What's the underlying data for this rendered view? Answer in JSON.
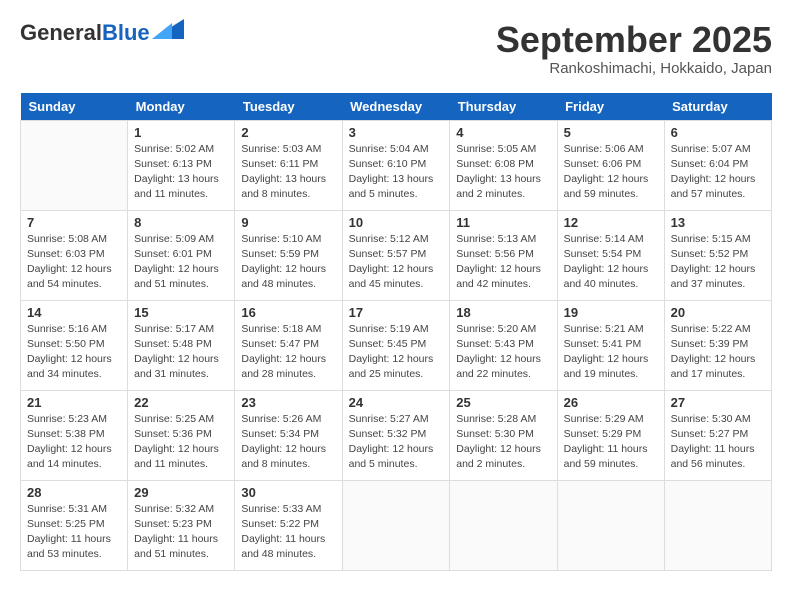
{
  "header": {
    "logo_general": "General",
    "logo_blue": "Blue",
    "month_title": "September 2025",
    "subtitle": "Rankoshimachi, Hokkaido, Japan"
  },
  "days_of_week": [
    "Sunday",
    "Monday",
    "Tuesday",
    "Wednesday",
    "Thursday",
    "Friday",
    "Saturday"
  ],
  "weeks": [
    [
      {
        "day": "",
        "info": ""
      },
      {
        "day": "1",
        "info": "Sunrise: 5:02 AM\nSunset: 6:13 PM\nDaylight: 13 hours\nand 11 minutes."
      },
      {
        "day": "2",
        "info": "Sunrise: 5:03 AM\nSunset: 6:11 PM\nDaylight: 13 hours\nand 8 minutes."
      },
      {
        "day": "3",
        "info": "Sunrise: 5:04 AM\nSunset: 6:10 PM\nDaylight: 13 hours\nand 5 minutes."
      },
      {
        "day": "4",
        "info": "Sunrise: 5:05 AM\nSunset: 6:08 PM\nDaylight: 13 hours\nand 2 minutes."
      },
      {
        "day": "5",
        "info": "Sunrise: 5:06 AM\nSunset: 6:06 PM\nDaylight: 12 hours\nand 59 minutes."
      },
      {
        "day": "6",
        "info": "Sunrise: 5:07 AM\nSunset: 6:04 PM\nDaylight: 12 hours\nand 57 minutes."
      }
    ],
    [
      {
        "day": "7",
        "info": "Sunrise: 5:08 AM\nSunset: 6:03 PM\nDaylight: 12 hours\nand 54 minutes."
      },
      {
        "day": "8",
        "info": "Sunrise: 5:09 AM\nSunset: 6:01 PM\nDaylight: 12 hours\nand 51 minutes."
      },
      {
        "day": "9",
        "info": "Sunrise: 5:10 AM\nSunset: 5:59 PM\nDaylight: 12 hours\nand 48 minutes."
      },
      {
        "day": "10",
        "info": "Sunrise: 5:12 AM\nSunset: 5:57 PM\nDaylight: 12 hours\nand 45 minutes."
      },
      {
        "day": "11",
        "info": "Sunrise: 5:13 AM\nSunset: 5:56 PM\nDaylight: 12 hours\nand 42 minutes."
      },
      {
        "day": "12",
        "info": "Sunrise: 5:14 AM\nSunset: 5:54 PM\nDaylight: 12 hours\nand 40 minutes."
      },
      {
        "day": "13",
        "info": "Sunrise: 5:15 AM\nSunset: 5:52 PM\nDaylight: 12 hours\nand 37 minutes."
      }
    ],
    [
      {
        "day": "14",
        "info": "Sunrise: 5:16 AM\nSunset: 5:50 PM\nDaylight: 12 hours\nand 34 minutes."
      },
      {
        "day": "15",
        "info": "Sunrise: 5:17 AM\nSunset: 5:48 PM\nDaylight: 12 hours\nand 31 minutes."
      },
      {
        "day": "16",
        "info": "Sunrise: 5:18 AM\nSunset: 5:47 PM\nDaylight: 12 hours\nand 28 minutes."
      },
      {
        "day": "17",
        "info": "Sunrise: 5:19 AM\nSunset: 5:45 PM\nDaylight: 12 hours\nand 25 minutes."
      },
      {
        "day": "18",
        "info": "Sunrise: 5:20 AM\nSunset: 5:43 PM\nDaylight: 12 hours\nand 22 minutes."
      },
      {
        "day": "19",
        "info": "Sunrise: 5:21 AM\nSunset: 5:41 PM\nDaylight: 12 hours\nand 19 minutes."
      },
      {
        "day": "20",
        "info": "Sunrise: 5:22 AM\nSunset: 5:39 PM\nDaylight: 12 hours\nand 17 minutes."
      }
    ],
    [
      {
        "day": "21",
        "info": "Sunrise: 5:23 AM\nSunset: 5:38 PM\nDaylight: 12 hours\nand 14 minutes."
      },
      {
        "day": "22",
        "info": "Sunrise: 5:25 AM\nSunset: 5:36 PM\nDaylight: 12 hours\nand 11 minutes."
      },
      {
        "day": "23",
        "info": "Sunrise: 5:26 AM\nSunset: 5:34 PM\nDaylight: 12 hours\nand 8 minutes."
      },
      {
        "day": "24",
        "info": "Sunrise: 5:27 AM\nSunset: 5:32 PM\nDaylight: 12 hours\nand 5 minutes."
      },
      {
        "day": "25",
        "info": "Sunrise: 5:28 AM\nSunset: 5:30 PM\nDaylight: 12 hours\nand 2 minutes."
      },
      {
        "day": "26",
        "info": "Sunrise: 5:29 AM\nSunset: 5:29 PM\nDaylight: 11 hours\nand 59 minutes."
      },
      {
        "day": "27",
        "info": "Sunrise: 5:30 AM\nSunset: 5:27 PM\nDaylight: 11 hours\nand 56 minutes."
      }
    ],
    [
      {
        "day": "28",
        "info": "Sunrise: 5:31 AM\nSunset: 5:25 PM\nDaylight: 11 hours\nand 53 minutes."
      },
      {
        "day": "29",
        "info": "Sunrise: 5:32 AM\nSunset: 5:23 PM\nDaylight: 11 hours\nand 51 minutes."
      },
      {
        "day": "30",
        "info": "Sunrise: 5:33 AM\nSunset: 5:22 PM\nDaylight: 11 hours\nand 48 minutes."
      },
      {
        "day": "",
        "info": ""
      },
      {
        "day": "",
        "info": ""
      },
      {
        "day": "",
        "info": ""
      },
      {
        "day": "",
        "info": ""
      }
    ]
  ]
}
